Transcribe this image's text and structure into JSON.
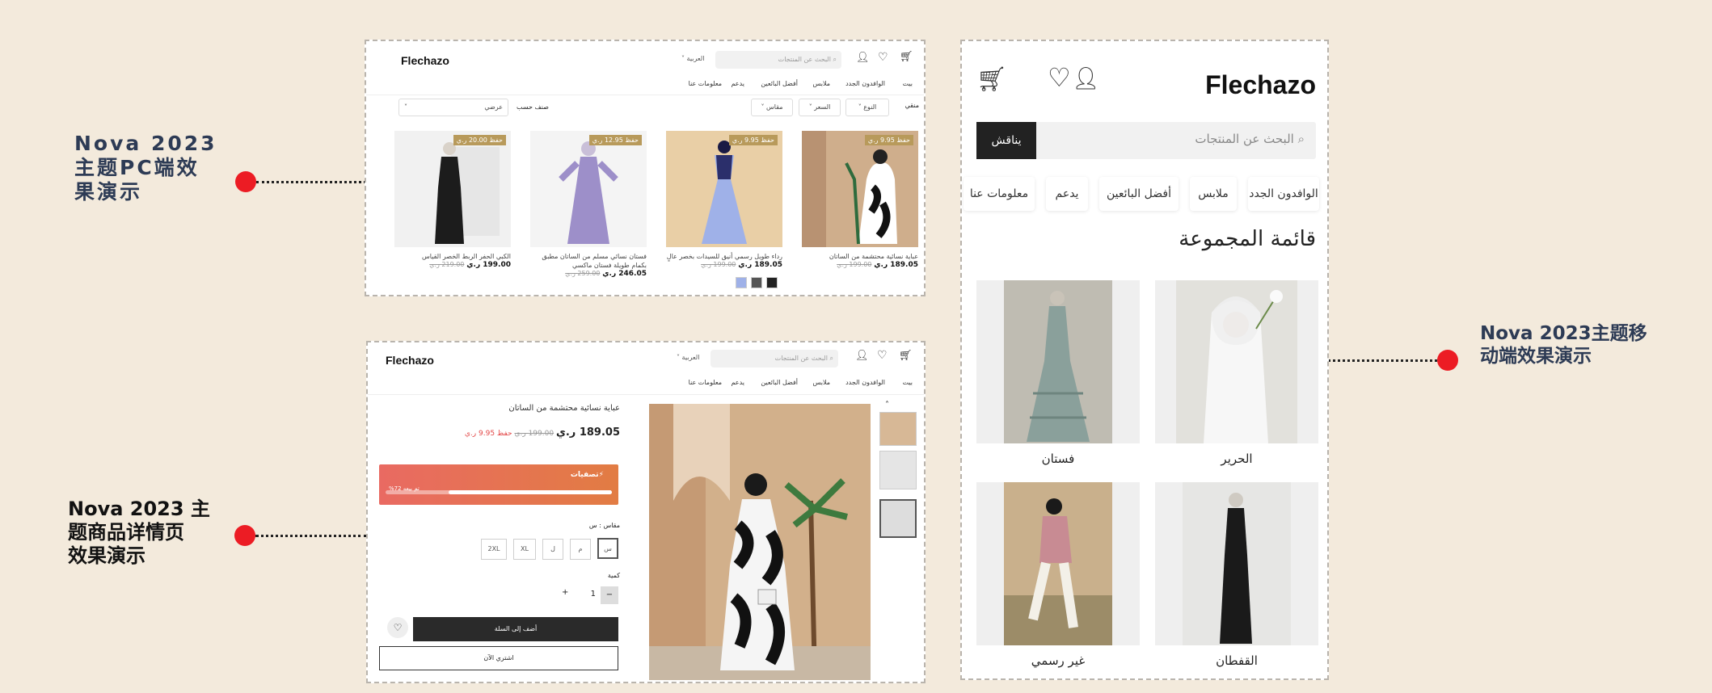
{
  "colors": {
    "background": "#f3eadc",
    "accent": "#ec1c24",
    "label": "#2d3b55",
    "badge": "#b89a5b",
    "gradient_start": "#e96a62",
    "gradient_end": "#e27c43"
  },
  "labels": {
    "pc": [
      "Nova 2023",
      "主题PC端效",
      "果演示"
    ],
    "detail": [
      "Nova 2023 主",
      "题商品详情页",
      "效果演示"
    ],
    "mobile": [
      "Nova 2023主题移",
      "动端效果演示"
    ]
  },
  "pc": {
    "logo": "Flechazo",
    "language": "العربية",
    "search_placeholder": "البحث عن المنتجات",
    "nav": [
      "بيت",
      "الوافدون الجدد",
      "ملابس",
      "أفضل البائعين",
      "يدعم",
      "معلومات عنا"
    ],
    "filters": {
      "filter_label": "منقي",
      "style": "النوع",
      "price": "السعر",
      "size": "مقاس",
      "sort_label": "صنف حسب",
      "sort_value": "عرضي"
    },
    "products": [
      {
        "badge": "حفظ 9.95 ر.ي",
        "name": "عباية نسائية محتشمة من الساتان",
        "price": "189.05 ر.ي",
        "old": "199.00 ر.ي"
      },
      {
        "badge": "حفظ 9.95 ر.ي",
        "name": "رداء طويل رسمي أنيق للسيدات بخصر عالٍ",
        "price": "189.05 ر.ي",
        "old": "199.00 ر.ي"
      },
      {
        "badge": "حفظ 12.95 ر.ي",
        "name": "فستان نسائي مسلم من الساتان مطبق بكمام طويلة فستان ماكسي",
        "price": "246.05 ر.ي",
        "old": "259.00 ر.ي"
      },
      {
        "badge": "حفظ 20.00 ر.ي",
        "name": "الكبي الحفر الربط الخصر القياس",
        "price": "199.00 ر.ي",
        "old": "219.00 ر.ي"
      }
    ]
  },
  "detail": {
    "logo": "Flechazo",
    "language": "العربية",
    "search_placeholder": "البحث عن المنتجات",
    "nav": [
      "بيت",
      "الوافدون الجدد",
      "ملابس",
      "أفضل البائعين",
      "يدعم",
      "معلومات عنا"
    ],
    "title": "عباية نسائية محتشمة من الساتان",
    "price": "189.05 ر.ي",
    "old_price": "199.00 ر.ي",
    "save": "حفظ 9.95 ر.ي",
    "sale_label": "تصفيات",
    "sold_label": "تم بيعه 72%",
    "sold_fraction": 0.72,
    "size_label": "مقاس : س",
    "sizes": [
      "س",
      "م",
      "ل",
      "XL",
      "2XL"
    ],
    "qty_label": "كمية",
    "qty": "1",
    "add_to_cart": "أضف إلى السلة",
    "buy_now": "اشتري الآن"
  },
  "mobile": {
    "logo": "Flechazo",
    "search_placeholder": "البحث عن المنتجات",
    "search_button": "يناقش",
    "chips": [
      "الوافدون الجدد",
      "ملابس",
      "أفضل البائعين",
      "يدعم",
      "معلومات عنا"
    ],
    "collection_title": "قائمة المجموعة",
    "collections": [
      "الحرير",
      "فستان",
      "القفطان",
      "غير رسمي"
    ]
  }
}
